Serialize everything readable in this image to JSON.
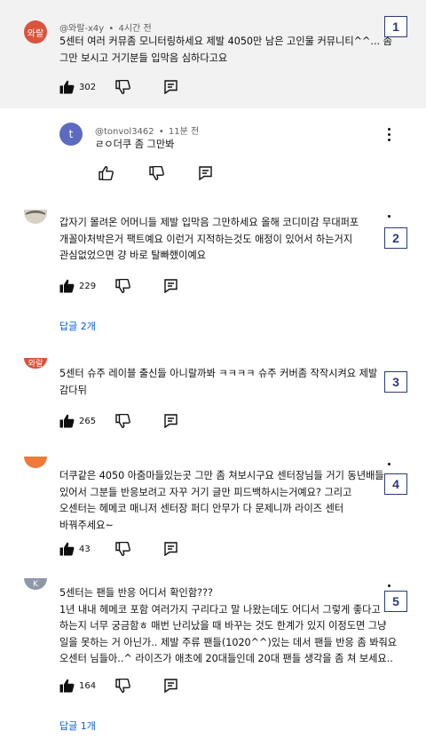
{
  "colors": {
    "highlight_bg": "#f2f2f2",
    "link": "#065fd4",
    "badge_border": "#2b3a77",
    "avatar_1": "#d9543c",
    "avatar_reply": "#5c6bc0",
    "avatar_4": "#f07a3c",
    "avatar_5": "#8f98a8"
  },
  "comments": [
    {
      "avatar_text": "와랄",
      "author": "@와랄-x4y",
      "sep": "•",
      "time": "4시간 전",
      "lines": [
        "5센터 여러 커뮤좀 모니터링하세요 제발 4050만 남은 고인물 커뮤니티^^... 좀",
        "그만 보시고 거기분들 입막음 심하다고요"
      ],
      "likes": "302",
      "badge": "1",
      "replies": [
        {
          "avatar_text": "t",
          "author": "@tonvol3462",
          "sep": "•",
          "time": "11분 전",
          "lines": [
            "ㄹㅇ더쿠 좀 그만봐"
          ]
        }
      ]
    },
    {
      "lines": [
        "갑자기 몰려온 어머니들 제발 입막음 그만하세요 올해 코디미감 무대퍼포",
        "개꼴아처박은거 팩트예요 이런거 지적하는것도 애정이 있어서 하는거지",
        "관심없었으면 걍 바로 탈빠했이예요"
      ],
      "likes": "229",
      "replies_label": "답글 2개",
      "badge": "2"
    },
    {
      "avatar_text": "와랄",
      "lines": [
        "5센터 슈주 레이블 출신들 아니랄까봐 ㅋㅋㅋㅋ 슈주 커버좀 작작시켜요 제발",
        "감다뒤"
      ],
      "likes": "265",
      "badge": "3"
    },
    {
      "lines": [
        "더쿠같은 4050 아줌마들있는곳 그만 좀 쳐보시구요 센터장님들 거기 동년배들",
        "있어서 그분들 반응보려고 자꾸 거기 글만 피드백하시는거예요? 그리고",
        "오센터는 헤메코 매니저 센터장 퍼디 안무가 다 문제니까 라이즈 센터",
        "바꿔주세요~"
      ],
      "likes": "43",
      "badge": "4"
    },
    {
      "avatar_text": "K",
      "lines": [
        "5센터는 팬들 반응 어디서 확인함???",
        "1년 내내 헤메코 포함 여러가지 구리다고 말 나왔는데도 어디서 그렇게 좋다고",
        "하는지 너무 궁금함ㅎ 매번 난리났을 때 바꾸는 것도 한계가 있지 이정도면 그냥",
        "일을 못하는 거 아닌가.. 제발 주류 팬들(1020^^)있는 데서 팬들 반응 좀 봐줘요",
        "오센터 님들아..^ 라이즈가 애초에 20대들인데 20대 팬들 생각을 좀 쳐 보세요.."
      ],
      "likes": "164",
      "replies_label": "답글 1개",
      "badge": "5"
    }
  ]
}
